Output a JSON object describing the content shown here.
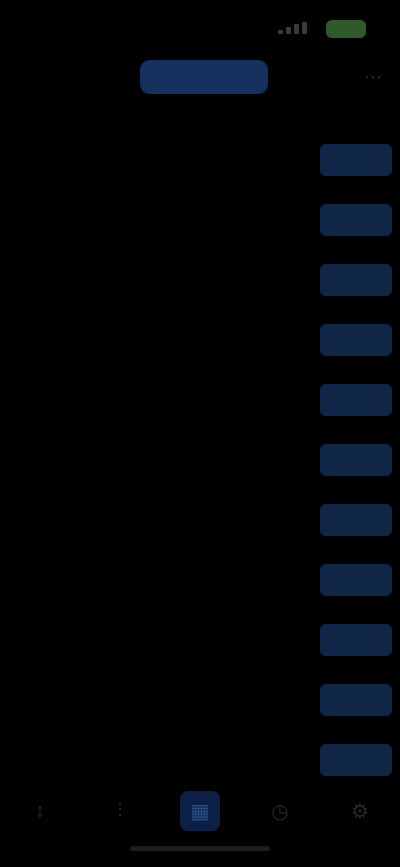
{
  "status_bar": {
    "time": "",
    "battery": ""
  },
  "header": {
    "segment_label": "",
    "action_icon": "more-icon"
  },
  "section": {
    "title": ""
  },
  "list": {
    "rows": [
      {
        "code": "",
        "change": "",
        "sub": "",
        "price": ""
      },
      {
        "code": "",
        "change": "",
        "sub": "",
        "price": ""
      },
      {
        "code": "",
        "change": "",
        "sub": "",
        "price": ""
      },
      {
        "code": "",
        "change": "",
        "sub": "",
        "price": ""
      },
      {
        "code": "",
        "change": "",
        "sub": "",
        "price": ""
      },
      {
        "code": "",
        "change": "",
        "sub": "",
        "price": ""
      },
      {
        "code": "",
        "change": "",
        "sub": "",
        "price": ""
      },
      {
        "code": "",
        "change": "",
        "sub": "",
        "price": ""
      },
      {
        "code": "",
        "change": "",
        "sub": "",
        "price": ""
      },
      {
        "code": "",
        "change": "",
        "sub": "",
        "price": ""
      },
      {
        "code": "",
        "change": "",
        "sub": "",
        "price": ""
      }
    ]
  },
  "tabs": [
    {
      "icon": "watchlist-icon",
      "active": false
    },
    {
      "icon": "chart-icon",
      "active": false
    },
    {
      "icon": "trade-icon",
      "active": true
    },
    {
      "icon": "history-icon",
      "active": false
    },
    {
      "icon": "settings-icon",
      "active": false
    }
  ],
  "colors": {
    "background": "#000000",
    "change_negative": "#4d1616",
    "price_button": "#0f2647",
    "accent": "#13315c"
  }
}
